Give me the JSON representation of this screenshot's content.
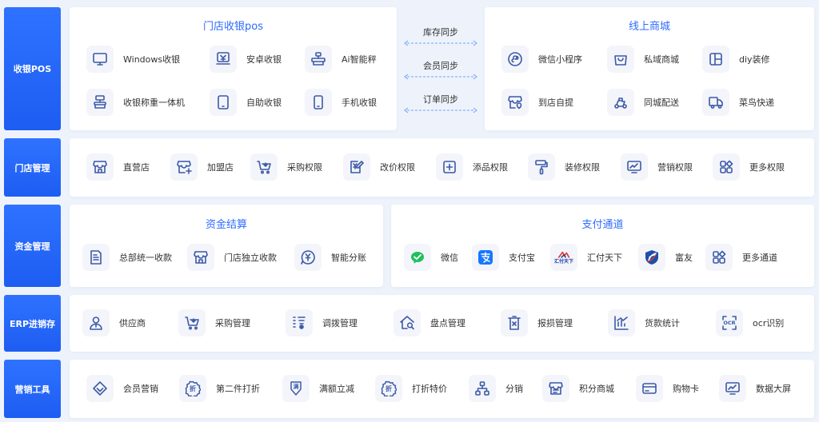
{
  "sidebar": [
    {
      "label": "收银POS"
    },
    {
      "label": "门店管理"
    },
    {
      "label": "资金管理"
    },
    {
      "label": "ERP进销存"
    },
    {
      "label": "营销工具"
    }
  ],
  "pos": {
    "store": {
      "title": "门店收银pos",
      "items": [
        {
          "label": "Windows收银",
          "icon": "monitor-icon"
        },
        {
          "label": "安卓收银",
          "icon": "cashier-icon"
        },
        {
          "label": "Ai智能秤",
          "icon": "scale-icon"
        },
        {
          "label": "收银称重一体机",
          "icon": "weigh-terminal-icon"
        },
        {
          "label": "自助收银",
          "icon": "tablet-icon"
        },
        {
          "label": "手机收银",
          "icon": "phone-icon"
        }
      ]
    },
    "sync": [
      {
        "label": "库存同步"
      },
      {
        "label": "会员同步"
      },
      {
        "label": "订单同步"
      }
    ],
    "online": {
      "title": "线上商城",
      "items": [
        {
          "label": "微信小程序",
          "icon": "mini-program-icon"
        },
        {
          "label": "私域商城",
          "icon": "shopping-bag-icon"
        },
        {
          "label": "diy装修",
          "icon": "layout-icon"
        },
        {
          "label": "到店自提",
          "icon": "store-pickup-icon"
        },
        {
          "label": "同城配送",
          "icon": "scooter-icon"
        },
        {
          "label": "菜鸟快递",
          "icon": "truck-icon"
        }
      ]
    }
  },
  "store_mgmt": {
    "items": [
      {
        "label": "直营店",
        "icon": "store-icon"
      },
      {
        "label": "加盟店",
        "icon": "store-plus-icon"
      },
      {
        "label": "采购权限",
        "icon": "cart-icon"
      },
      {
        "label": "改价权限",
        "icon": "price-edit-icon"
      },
      {
        "label": "添品权限",
        "icon": "add-square-icon"
      },
      {
        "label": "装修权限",
        "icon": "paint-roller-icon"
      },
      {
        "label": "营销权限",
        "icon": "chart-screen-icon"
      },
      {
        "label": "更多权限",
        "icon": "grid-more-icon"
      }
    ]
  },
  "finance": {
    "settlement": {
      "title": "资金结算",
      "items": [
        {
          "label": "总部统一收款",
          "icon": "document-icon"
        },
        {
          "label": "门店独立收款",
          "icon": "store-icon"
        },
        {
          "label": "智能分账",
          "icon": "money-chat-icon"
        }
      ]
    },
    "payment": {
      "title": "支付通道",
      "items": [
        {
          "label": "微信",
          "icon": "wechat-icon"
        },
        {
          "label": "支付宝",
          "icon": "alipay-icon"
        },
        {
          "label": "汇付天下",
          "icon": "huifu-icon",
          "logo_text": "汇付天下"
        },
        {
          "label": "富友",
          "icon": "fuyou-icon"
        },
        {
          "label": "更多通道",
          "icon": "grid-more-icon"
        }
      ]
    }
  },
  "erp": {
    "items": [
      {
        "label": "供应商",
        "icon": "person-icon"
      },
      {
        "label": "采购管理",
        "icon": "cart-icon"
      },
      {
        "label": "调拨管理",
        "icon": "transfer-icon"
      },
      {
        "label": "盘点管理",
        "icon": "house-search-icon"
      },
      {
        "label": "报损管理",
        "icon": "trash-box-icon"
      },
      {
        "label": "货款统计",
        "icon": "bar-chart-icon"
      },
      {
        "label": "ocr识别",
        "icon": "ocr-icon",
        "icon_text": "OCR"
      }
    ]
  },
  "marketing": {
    "items": [
      {
        "label": "会员营销",
        "icon": "diamond-icon"
      },
      {
        "label": "第二件打折",
        "icon": "discount-badge-icon",
        "icon_text": "折"
      },
      {
        "label": "满额立减",
        "icon": "coupon-down-icon",
        "icon_text": "满"
      },
      {
        "label": "打折特价",
        "icon": "discount-badge-icon",
        "icon_text": "折"
      },
      {
        "label": "分销",
        "icon": "network-icon"
      },
      {
        "label": "积分商城",
        "icon": "points-store-icon"
      },
      {
        "label": "购物卡",
        "icon": "card-icon"
      },
      {
        "label": "数据大屏",
        "icon": "dashboard-screen-icon"
      }
    ]
  },
  "colors": {
    "accent": "#2f6bff",
    "sidebar": "#2f72ff",
    "icon_stroke": "#3d5aa8",
    "background": "#eef3fb",
    "wechat": "#20c05c",
    "alipay": "#1677ff"
  }
}
